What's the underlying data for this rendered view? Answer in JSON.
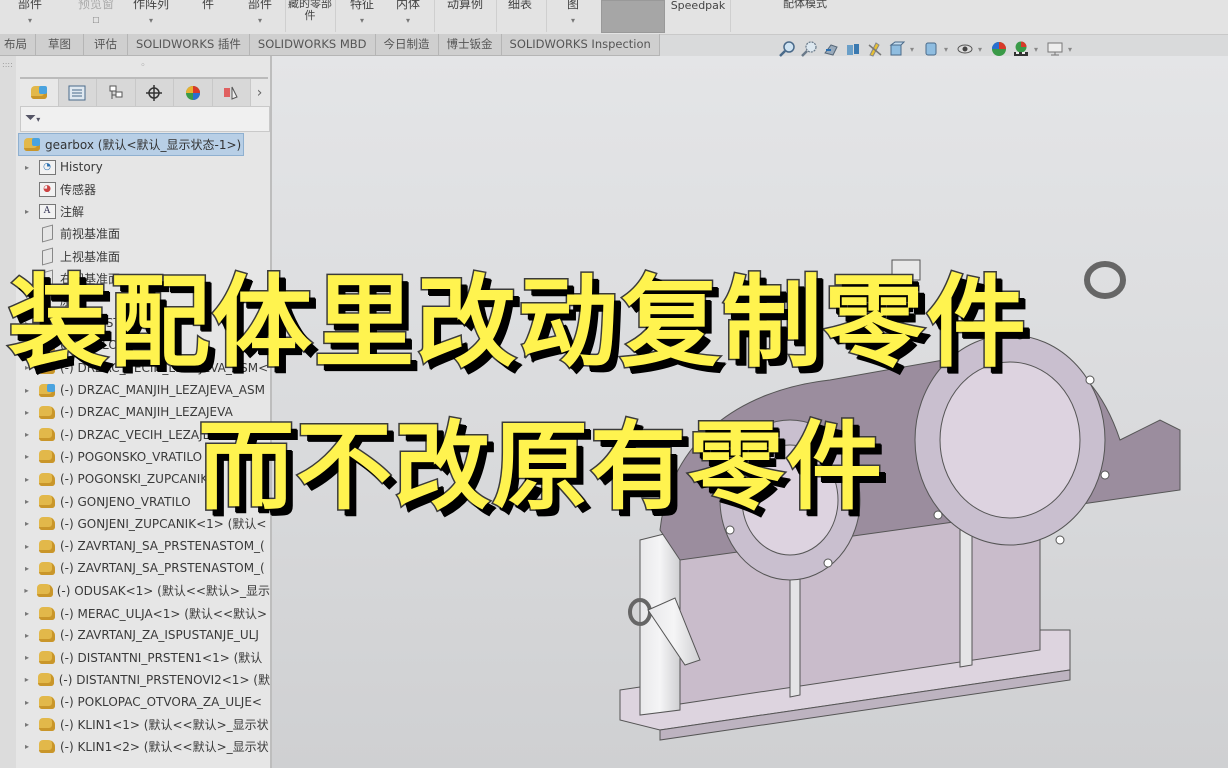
{
  "ribbon": {
    "buttons": [
      {
        "label": "部件",
        "has_caret": true
      },
      {
        "label": "预览窗",
        "has_caret": false
      },
      {
        "label": "作阵列",
        "has_caret": true
      },
      {
        "label": "件",
        "has_caret": false
      },
      {
        "label": "部件",
        "has_caret": true
      },
      {
        "label": "藏的零部件",
        "has_caret": false
      },
      {
        "label": "特征",
        "has_caret": true
      },
      {
        "label": "内体",
        "has_caret": true
      },
      {
        "label": "动算例",
        "has_caret": false
      },
      {
        "label": "细表",
        "has_caret": false
      },
      {
        "label": "图",
        "has_caret": true
      },
      {
        "label": "Speedpak",
        "has_caret": false
      },
      {
        "label": "配体模式",
        "has_caret": false
      }
    ]
  },
  "tabs": [
    "布局",
    "草图",
    "评估",
    "SOLIDWORKS 插件",
    "SOLIDWORKS MBD",
    "今日制造",
    "博士钣金",
    "SOLIDWORKS Inspection"
  ],
  "view_toolbar": {
    "icons": [
      "zoom-to-fit-icon",
      "zoom-to-area-icon",
      "previous-view-icon",
      "section-view-icon",
      "dynamic-annotation-icon",
      "view-orientation-icon",
      "display-style-icon",
      "hide-show-items-icon",
      "edit-appearance-icon",
      "apply-scene-icon",
      "view-settings-icon"
    ]
  },
  "feature_manager": {
    "panel_tabs": [
      "feature-manager-tab",
      "property-manager-tab",
      "configuration-manager-tab",
      "dimxpert-manager-tab",
      "display-manager-tab",
      "cam-tab"
    ],
    "root": {
      "label": "gearbox  (默认<默认_显示状态-1>)"
    },
    "items": [
      {
        "label": "History",
        "icon": "history-folder",
        "expandable": true
      },
      {
        "label": "传感器",
        "icon": "sensor-folder",
        "expandable": false
      },
      {
        "label": "注解",
        "icon": "annotation-folder",
        "expandable": true
      },
      {
        "label": "前视基准面",
        "icon": "plane",
        "expandable": false
      },
      {
        "label": "上视基准面",
        "icon": "plane",
        "expandable": false
      },
      {
        "label": "右视基准面",
        "icon": "plane",
        "expandable": false
      },
      {
        "label": "原点",
        "icon": "origin",
        "expandable": false
      },
      {
        "label": "(-) KUCISTE<1>",
        "icon": "part",
        "expandable": true
      },
      {
        "label": "(-) POKLOPAC<1>",
        "icon": "part",
        "expandable": true
      },
      {
        "label": "(-) DRZAC_VECIH_LEZAJEVA_ASM<",
        "icon": "assembly",
        "expandable": true
      },
      {
        "label": "(-) DRZAC_MANJIH_LEZAJEVA_ASM",
        "icon": "assembly",
        "expandable": true
      },
      {
        "label": "(-) DRZAC_MANJIH_LEZAJEVA",
        "icon": "part",
        "expandable": true
      },
      {
        "label": "(-) DRZAC_VECIH_LEZAJEVA",
        "icon": "part",
        "expandable": true
      },
      {
        "label": "(-) POGONSKO_VRATILO",
        "icon": "part",
        "expandable": true
      },
      {
        "label": "(-) POGONSKI_ZUPCANIK",
        "icon": "part",
        "expandable": true
      },
      {
        "label": "(-) GONJENO_VRATILO",
        "icon": "part",
        "expandable": true
      },
      {
        "label": "(-) GONJENI_ZUPCANIK<1> (默认<",
        "icon": "part",
        "expandable": true
      },
      {
        "label": "(-) ZAVRTANJ_SA_PRSTENASTOM_(",
        "icon": "part",
        "expandable": true
      },
      {
        "label": "(-) ZAVRTANJ_SA_PRSTENASTOM_(",
        "icon": "part",
        "expandable": true
      },
      {
        "label": "(-) ODUSAK<1> (默认<<默认>_显示",
        "icon": "part",
        "expandable": true
      },
      {
        "label": "(-) MERAC_ULJA<1> (默认<<默认>",
        "icon": "part",
        "expandable": true
      },
      {
        "label": "(-) ZAVRTANJ_ZA_ISPUSTANJE_ULJ",
        "icon": "part",
        "expandable": true
      },
      {
        "label": "(-) DISTANTNI_PRSTEN1<1> (默认",
        "icon": "part",
        "expandable": true
      },
      {
        "label": "(-) DISTANTNI_PRSTENOVI2<1> (默",
        "icon": "part",
        "expandable": true
      },
      {
        "label": "(-) POKLOPAC_OTVORA_ZA_ULJE<",
        "icon": "part",
        "expandable": true
      },
      {
        "label": "(-) KLIN1<1> (默认<<默认>_显示状",
        "icon": "part",
        "expandable": true
      },
      {
        "label": "(-) KLIN1<2> (默认<<默认>_显示状",
        "icon": "part",
        "expandable": true
      }
    ]
  },
  "overlay": {
    "line1": "装配体里改动复制零件",
    "line2": "而不改原有零件"
  }
}
